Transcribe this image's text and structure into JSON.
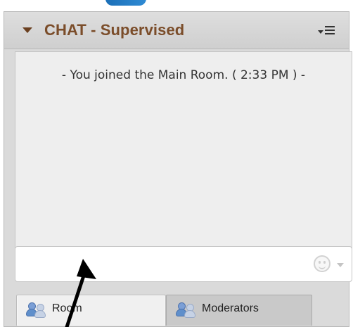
{
  "panel": {
    "title": "CHAT - Supervised",
    "collapse_icon": "collapse-triangle-icon",
    "menu_icon": "panel-menu-icon"
  },
  "chat": {
    "messages": [
      "- You joined the Main Room. ( 2:33 PM ) -"
    ]
  },
  "input": {
    "value": "",
    "placeholder": "",
    "emoji_icon": "smiley-icon"
  },
  "tabs": [
    {
      "label": "Room",
      "icon": "users-icon",
      "selected": true
    },
    {
      "label": "Moderators",
      "icon": "users-icon",
      "selected": false
    }
  ],
  "colors": {
    "title": "#7b4d2a",
    "panel_bg": "#dadada",
    "message_area": "#eeeeee",
    "accent_blue": "#1b6fb7",
    "annotation_arrow": "#000000"
  },
  "overlay": {
    "annotation_arrow_icon": "pointer-arrow-icon"
  }
}
